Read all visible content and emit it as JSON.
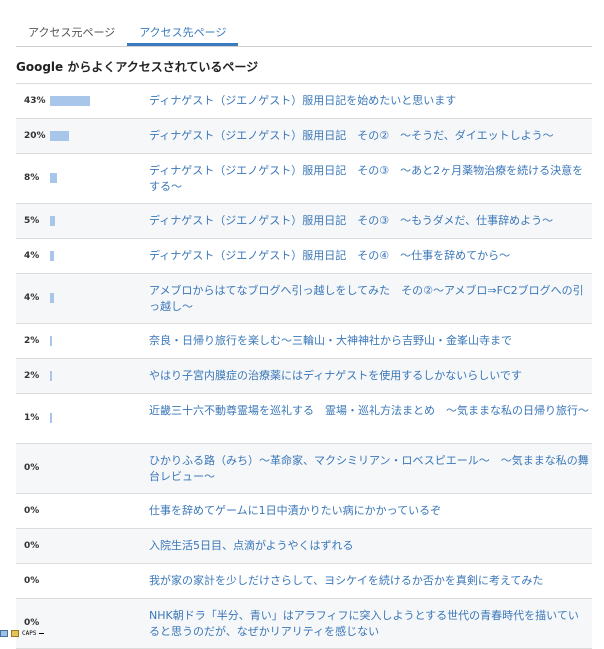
{
  "tabs": [
    {
      "label": "アクセス元ページ",
      "active": false
    },
    {
      "label": "アクセス先ページ",
      "active": true
    }
  ],
  "section_title": "Google からよくアクセスされているページ",
  "colors": {
    "accent": "#3a7bbf",
    "link": "#3a77b8",
    "bar": "#a7c6ea"
  },
  "rows": [
    {
      "percent": "43%",
      "value": 43,
      "title": "ディナゲスト（ジエノゲスト）服用日記を始めたいと思います"
    },
    {
      "percent": "20%",
      "value": 20,
      "title": "ディナゲスト（ジエノゲスト）服用日記　その②　～そうだ、ダイエットしよう～"
    },
    {
      "percent": "8%",
      "value": 8,
      "title": "ディナゲスト（ジエノゲスト）服用日記　その③　～あと2ヶ月薬物治療を続ける決意をする～"
    },
    {
      "percent": "5%",
      "value": 5,
      "title": "ディナゲスト（ジエノゲスト）服用日記　その③　～もうダメだ、仕事辞めよう～"
    },
    {
      "percent": "4%",
      "value": 4,
      "title": "ディナゲスト（ジエノゲスト）服用日記　その④　～仕事を辞めてから～"
    },
    {
      "percent": "4%",
      "value": 4,
      "title": "アメブロからはてなブログへ引っ越しをしてみた　その②～アメブロ⇒FC2ブログへの引っ越し～"
    },
    {
      "percent": "2%",
      "value": 2,
      "title": "奈良・日帰り旅行を楽しむ～三輪山・大神神社から吉野山・金峯山寺まで"
    },
    {
      "percent": "2%",
      "value": 2,
      "title": "やはり子宮内膜症の治療薬にはディナゲストを使用するしかないらしいです"
    },
    {
      "percent": "1%",
      "value": 1,
      "title": "近畿三十六不動尊霊場を巡礼する　霊場・巡礼方法まとめ　～気ままな私の日帰り旅行～"
    },
    {
      "percent": "0%",
      "value": 0,
      "title": "ひかりふる路（みち）～革命家、マクシミリアン・ロベスピエール～　～気ままな私の舞台レビュー～"
    },
    {
      "percent": "0%",
      "value": 0,
      "title": "仕事を辞めてゲームに1日中漬かりたい病にかかっているぞ"
    },
    {
      "percent": "0%",
      "value": 0,
      "title": "入院生活5日目、点滴がようやくはずれる"
    },
    {
      "percent": "0%",
      "value": 0,
      "title": "我が家の家計を少しだけさらして、ヨシケイを続けるか否かを真剣に考えてみた"
    },
    {
      "percent": "0%",
      "value": 0,
      "title": "NHK朝ドラ「半分、青い」はアラフィフに突入しようとする世代の青春時代を描いていると思うのだが、なぜかリアリティを感じない"
    }
  ],
  "statusbar": {
    "caps_label": "CAPS"
  }
}
